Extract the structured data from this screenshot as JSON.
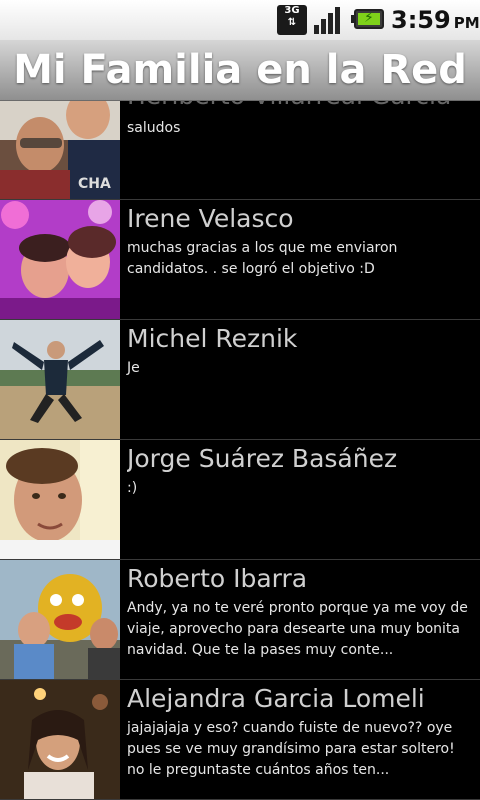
{
  "status_bar": {
    "network_label": "3G",
    "network_icon": "3g-data-icon",
    "signal_icon": "signal-strength-icon",
    "battery_icon": "battery-charging-icon",
    "time": "3:59",
    "ampm": "PM"
  },
  "app": {
    "title": "Mi Familia en la Red"
  },
  "contacts": [
    {
      "name": "Heriberto Villarreal García",
      "message": "saludos"
    },
    {
      "name": "Irene Velasco",
      "message": "muchas gracias a los que me enviaron candidatos. . se logró el objetivo :D"
    },
    {
      "name": "Michel Reznik",
      "message": "Je"
    },
    {
      "name": "Jorge Suárez Basáñez",
      "message": ":)"
    },
    {
      "name": "Roberto Ibarra",
      "message": "Andy, ya no te veré pronto porque ya me voy de viaje, aprovecho para desearte una muy bonita navidad. Que te la pases muy conte..."
    },
    {
      "name": "Alejandra Garcia Lomeli",
      "message": "jajajajaja y eso? cuando fuiste de nuevo?? oye pues se ve muy grandísimo para estar soltero! no le preguntaste cuántos años ten..."
    }
  ],
  "photo_text": {
    "shirt_label": "CHA"
  }
}
